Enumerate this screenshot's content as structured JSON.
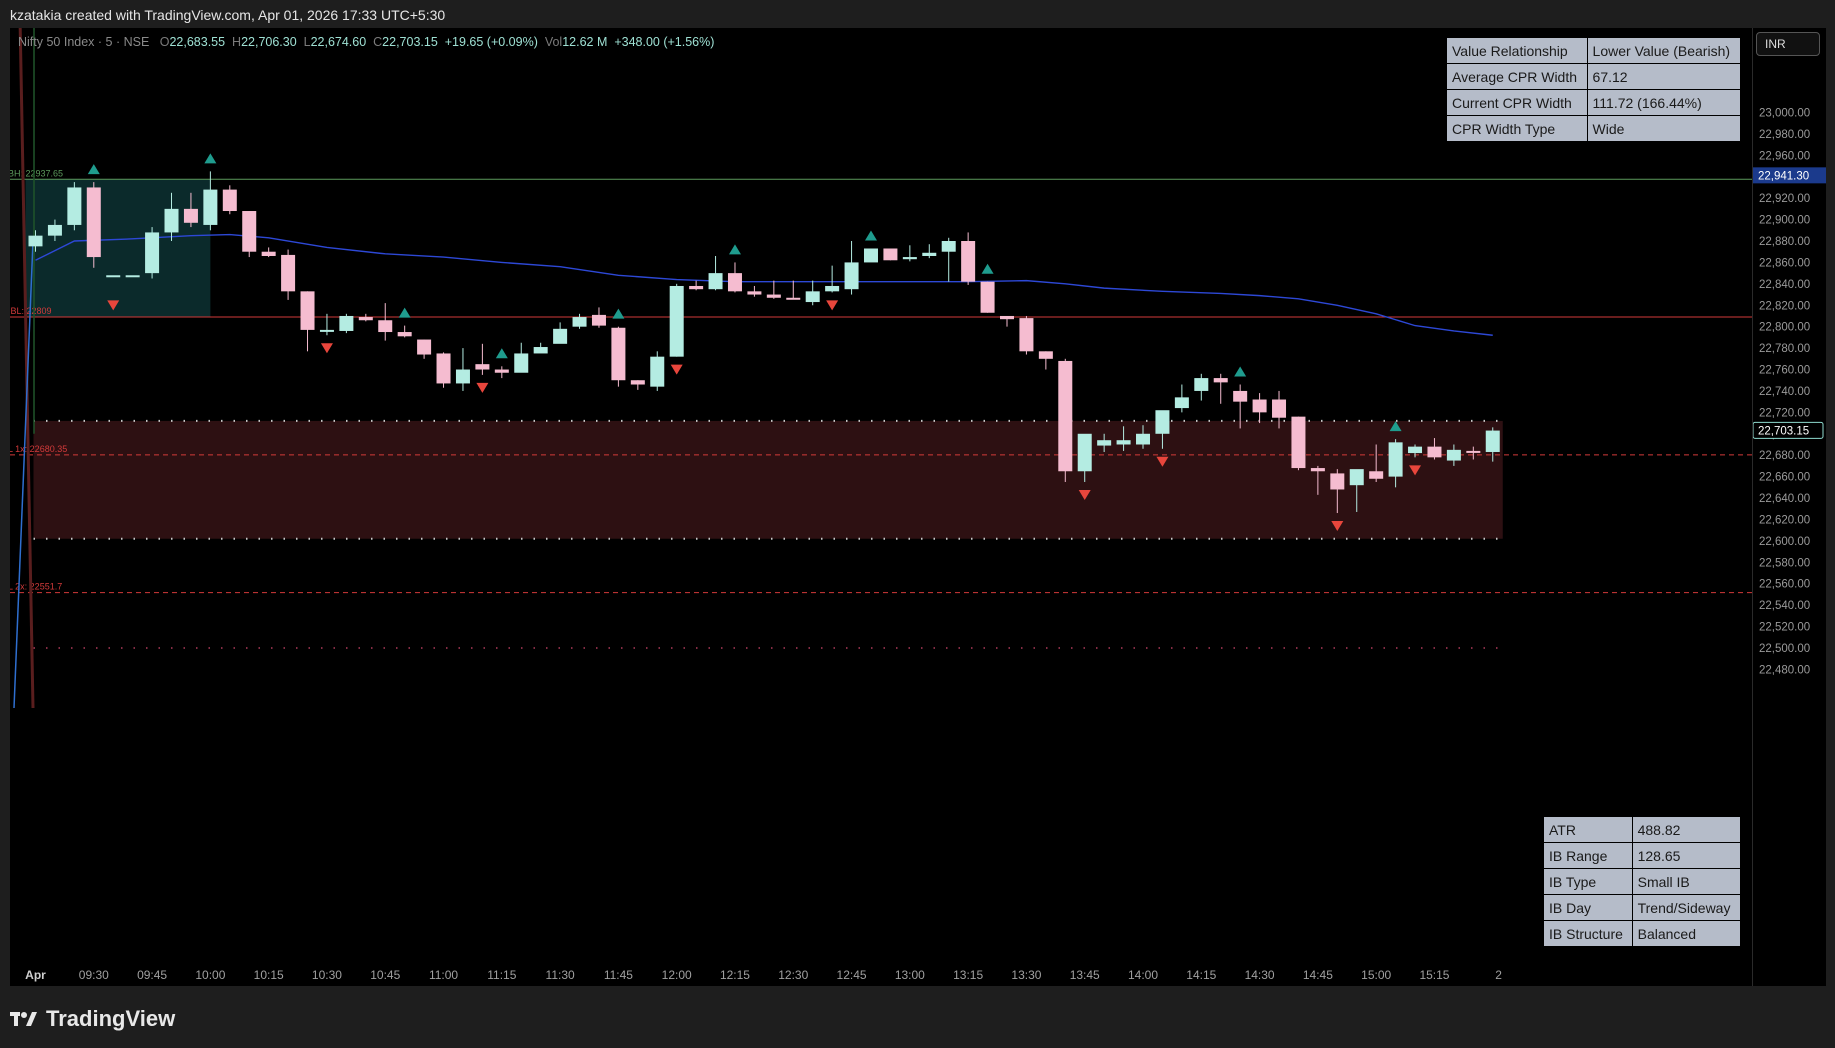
{
  "header": {
    "attribution": "kzatakia created with TradingView.com, Apr 01, 2026 17:33 UTC+5:30"
  },
  "legend": {
    "symbol": "Nifty 50 Index · 5 · NSE",
    "open_label": "O",
    "open": "22,683.55",
    "high_label": "H",
    "high": "22,706.30",
    "low_label": "L",
    "low": "22,674.60",
    "close_label": "C",
    "close": "22,703.15",
    "change": "+19.65 (+0.09%)",
    "vol_label": "Vol",
    "vol": "12.62 M",
    "extra": "+348.00 (+1.56%)"
  },
  "currency": "INR",
  "cpr_table": [
    [
      "Value Relationship",
      "Lower Value (Bearish)"
    ],
    [
      "Average CPR Width",
      "67.12"
    ],
    [
      "Current CPR Width",
      "111.72 (166.44%)"
    ],
    [
      "CPR Width Type",
      "Wide"
    ]
  ],
  "ib_table": [
    [
      "ATR",
      "488.82"
    ],
    [
      "IB Range",
      "128.65"
    ],
    [
      "IB Type",
      "Small IB"
    ],
    [
      "IB Day",
      "Trend/Sideway"
    ],
    [
      "IB Structure",
      "Balanced"
    ]
  ],
  "footer": {
    "brand": "TradingView"
  },
  "chart_data": {
    "type": "candlestick",
    "y_range": [
      22470,
      23020
    ],
    "y_ticks": [
      23000,
      22980,
      22960,
      22940,
      22920,
      22900,
      22880,
      22860,
      22840,
      22820,
      22800,
      22780,
      22760,
      22740,
      22720,
      22700,
      22680,
      22660,
      22640,
      22620,
      22600,
      22580,
      22560,
      22540,
      22520,
      22500,
      22480
    ],
    "x_ticks": [
      {
        "label": "Apr",
        "i": 0
      },
      {
        "label": "09:30",
        "i": 3
      },
      {
        "label": "09:45",
        "i": 6
      },
      {
        "label": "10:00",
        "i": 9
      },
      {
        "label": "10:15",
        "i": 12
      },
      {
        "label": "10:30",
        "i": 15
      },
      {
        "label": "10:45",
        "i": 18
      },
      {
        "label": "11:00",
        "i": 21
      },
      {
        "label": "11:15",
        "i": 24
      },
      {
        "label": "11:30",
        "i": 27
      },
      {
        "label": "11:45",
        "i": 30
      },
      {
        "label": "12:00",
        "i": 33
      },
      {
        "label": "12:15",
        "i": 36
      },
      {
        "label": "12:30",
        "i": 39
      },
      {
        "label": "12:45",
        "i": 42
      },
      {
        "label": "13:00",
        "i": 45
      },
      {
        "label": "13:15",
        "i": 48
      },
      {
        "label": "13:30",
        "i": 51
      },
      {
        "label": "13:45",
        "i": 54
      },
      {
        "label": "14:00",
        "i": 57
      },
      {
        "label": "14:15",
        "i": 60
      },
      {
        "label": "14:30",
        "i": 63
      },
      {
        "label": "14:45",
        "i": 66
      },
      {
        "label": "15:00",
        "i": 69
      },
      {
        "label": "15:15",
        "i": 72
      },
      {
        "label": "2",
        "i": 75.3
      }
    ],
    "candles": [
      [
        22875,
        22890,
        22870,
        22885
      ],
      [
        22885,
        22900,
        22880,
        22895
      ],
      [
        22895,
        22935,
        22890,
        22930
      ],
      [
        22930,
        22935,
        22855,
        22865
      ],
      [
        22848,
        22832,
        22832,
        22848
      ],
      [
        22848,
        22832,
        22832,
        22848
      ],
      [
        22850,
        22893,
        22845,
        22888
      ],
      [
        22888,
        22925,
        22880,
        22910
      ],
      [
        22910,
        22925,
        22893,
        22897
      ],
      [
        22895,
        22945,
        22890,
        22928
      ],
      [
        22928,
        22932,
        22905,
        22908
      ],
      [
        22908,
        22908,
        22865,
        22870
      ],
      [
        22870,
        22874,
        22865,
        22866
      ],
      [
        22867,
        22872,
        22825,
        22833
      ],
      [
        22833,
        22833,
        22777,
        22797
      ],
      [
        22797,
        22812,
        22792,
        22797
      ],
      [
        22796,
        22812,
        22794,
        22810
      ],
      [
        22809,
        22812,
        22805,
        22806
      ],
      [
        22806,
        22822,
        22787,
        22795
      ],
      [
        22795,
        22801,
        22790,
        22791
      ],
      [
        22788,
        22788,
        22770,
        22774
      ],
      [
        22775,
        22776,
        22743,
        22747
      ],
      [
        22747,
        22780,
        22740,
        22760
      ],
      [
        22765,
        22784,
        22755,
        22760
      ],
      [
        22760,
        22763,
        22752,
        22757
      ],
      [
        22757,
        22785,
        22766,
        22775
      ],
      [
        22775,
        22785,
        22781,
        22781
      ],
      [
        22784,
        22804,
        22790,
        22798
      ],
      [
        22800,
        22812,
        22798,
        22809
      ],
      [
        22811,
        22818,
        22799,
        22801
      ],
      [
        22799,
        22800,
        22744,
        22750
      ],
      [
        22750,
        22750,
        22741,
        22746
      ],
      [
        22744,
        22777,
        22740,
        22772
      ],
      [
        22772,
        22840,
        22772,
        22838
      ],
      [
        22838,
        22843,
        22834,
        22835
      ],
      [
        22835,
        22866,
        22834,
        22850
      ],
      [
        22850,
        22860,
        22832,
        22833
      ],
      [
        22833,
        22838,
        22828,
        22830
      ],
      [
        22830,
        22843,
        22826,
        22827
      ],
      [
        22827,
        22843,
        22826,
        22826
      ],
      [
        22823,
        22843,
        22820,
        22833
      ],
      [
        22833,
        22857,
        22832,
        22838
      ],
      [
        22835,
        22880,
        22830,
        22860
      ],
      [
        22860,
        22873,
        22862,
        22873
      ],
      [
        22873,
        22873,
        22862,
        22862
      ],
      [
        22863,
        22876,
        22861,
        22865
      ],
      [
        22866,
        22877,
        22864,
        22869
      ],
      [
        22870,
        22883,
        22842,
        22880
      ],
      [
        22880,
        22888,
        22839,
        22842
      ],
      [
        22842,
        22842,
        22813,
        22813
      ],
      [
        22810,
        22810,
        22800,
        22807
      ],
      [
        22808,
        22810,
        22774,
        22777
      ],
      [
        22777,
        22777,
        22760,
        22770
      ],
      [
        22768,
        22770,
        22655,
        22665
      ],
      [
        22665,
        22690,
        22655,
        22700
      ],
      [
        22689,
        22700,
        22683,
        22694
      ],
      [
        22690,
        22707,
        22684,
        22694
      ],
      [
        22690,
        22708,
        22686,
        22700
      ],
      [
        22700,
        22715,
        22686,
        22722
      ],
      [
        22724,
        22746,
        22720,
        22734
      ],
      [
        22740,
        22756,
        22731,
        22752
      ],
      [
        22752,
        22756,
        22728,
        22748
      ],
      [
        22740,
        22746,
        22705,
        22730
      ],
      [
        22732,
        22738,
        22710,
        22720
      ],
      [
        22732,
        22740,
        22705,
        22715
      ],
      [
        22716,
        22716,
        22666,
        22668
      ],
      [
        22668,
        22670,
        22643,
        22665
      ],
      [
        22663,
        22667,
        22626,
        22648
      ],
      [
        22652,
        22665,
        22627,
        22667
      ],
      [
        22665,
        22690,
        22655,
        22658
      ],
      [
        22660,
        22695,
        22650,
        22692
      ],
      [
        22682,
        22690,
        22678,
        22688
      ],
      [
        22688,
        22696,
        22676,
        22678
      ],
      [
        22675,
        22690,
        22670,
        22685
      ],
      [
        22684,
        22688,
        22676,
        22683
      ],
      [
        22683,
        22706,
        22674,
        22703
      ]
    ],
    "up_signals": [
      3,
      9,
      19,
      24,
      30,
      36,
      43,
      49,
      62,
      70
    ],
    "down_signals": [
      4,
      15,
      23,
      33,
      41,
      54,
      58,
      67,
      71
    ],
    "levels": [
      {
        "label": "BH: 22937.65",
        "value": 22937.65
      },
      {
        "label": "IBL: 22809",
        "value": 22809
      },
      {
        "label": "L 1x: 22680.35",
        "value": 22680.35
      },
      {
        "label": "L 2x: 22551.7",
        "value": 22551.7
      }
    ],
    "zone": {
      "top": 22712,
      "bottom": 22602
    },
    "ib_box": {
      "top": 22937.65,
      "bottom": 22809,
      "from": 0,
      "to": 9
    },
    "lower_dotted": 22500,
    "high_label": "High",
    "high_value": "22,941.30",
    "last_value": "22,703.15",
    "ma": [
      [
        0,
        22862
      ],
      [
        2,
        22880
      ],
      [
        5,
        22882
      ],
      [
        8,
        22885
      ],
      [
        10,
        22886
      ],
      [
        12,
        22883
      ],
      [
        15,
        22874
      ],
      [
        18,
        22868
      ],
      [
        21,
        22865
      ],
      [
        24,
        22860
      ],
      [
        27,
        22856
      ],
      [
        30,
        22848
      ],
      [
        33,
        22844
      ],
      [
        36,
        22842
      ],
      [
        40,
        22842
      ],
      [
        45,
        22842
      ],
      [
        48,
        22842
      ],
      [
        51,
        22843
      ],
      [
        53,
        22840
      ],
      [
        55,
        22836
      ],
      [
        58,
        22833
      ],
      [
        61,
        22831
      ],
      [
        63,
        22829
      ],
      [
        65,
        22826
      ],
      [
        67,
        22820
      ],
      [
        69,
        22812
      ],
      [
        71,
        22801
      ],
      [
        73,
        22796
      ],
      [
        75,
        22792
      ]
    ]
  }
}
